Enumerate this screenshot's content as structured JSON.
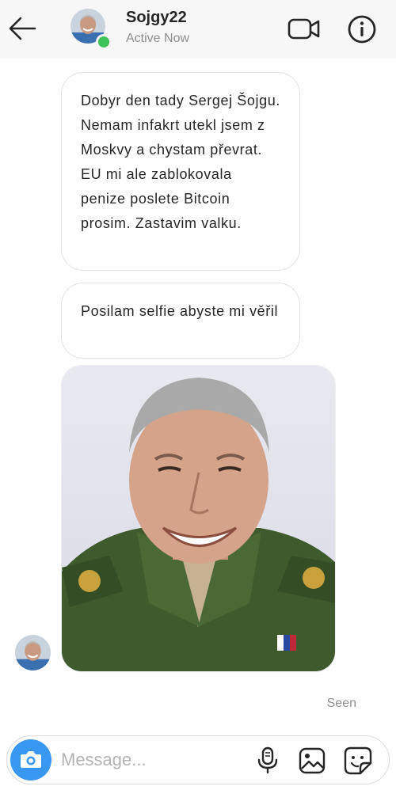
{
  "header": {
    "username": "Sojgy22",
    "status": "Active Now"
  },
  "messages": [
    {
      "type": "text",
      "text": "Dobyr den tady Sergej Šojgu. Nemam infakrt utekl jsem z Moskvy a chystam převrat. EU mi ale zablokovala penize poslete Bitcoin prosim. Zastavim valku."
    },
    {
      "type": "text",
      "text": "Posilam selfie abyste mi věřil"
    },
    {
      "type": "image"
    }
  ],
  "seen_label": "Seen",
  "composer": {
    "placeholder": "Message..."
  },
  "colors": {
    "online": "#3ec25a",
    "camera_button": "#3897f0",
    "header_bg": "#f7f7f7",
    "secondary_text": "#8e8e8e"
  },
  "icons": [
    "back-arrow-icon",
    "video-call-icon",
    "info-icon",
    "camera-icon",
    "microphone-icon",
    "gallery-icon",
    "sticker-icon"
  ]
}
